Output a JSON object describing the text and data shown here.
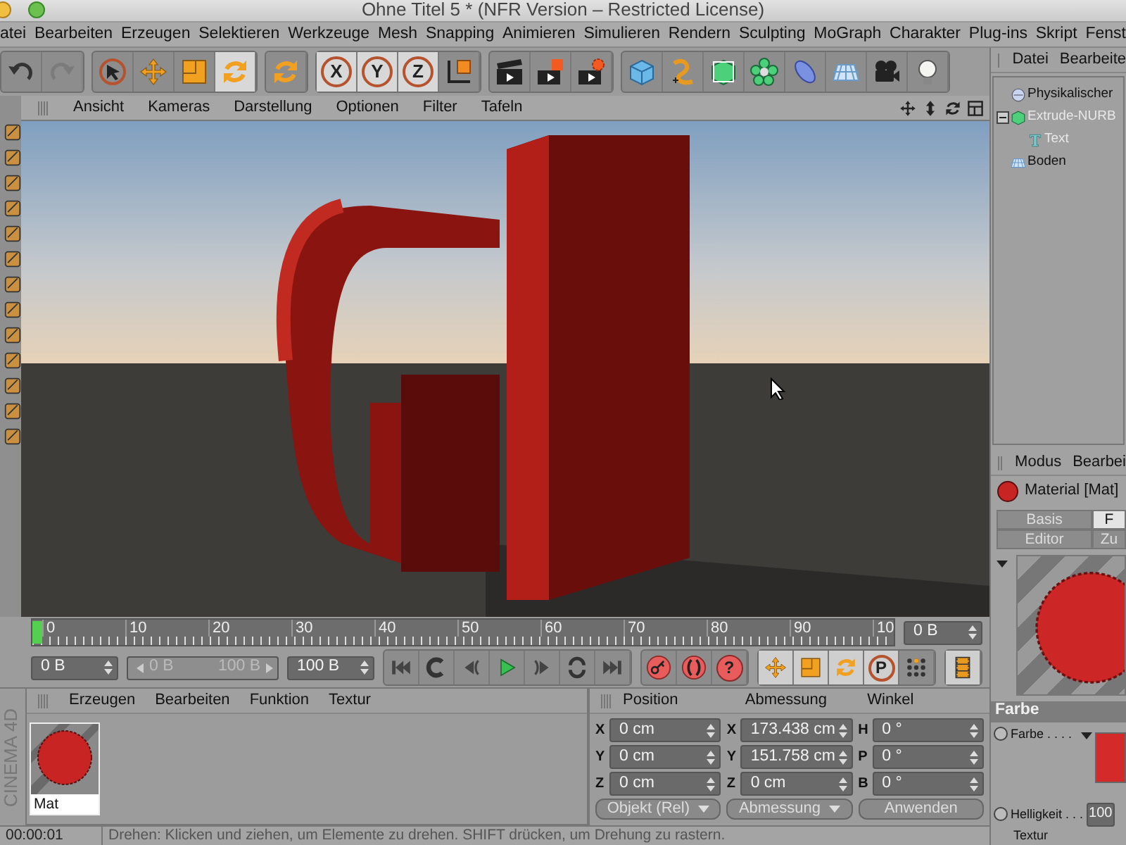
{
  "window": {
    "title": "Ohne Titel 5 * (NFR Version – Restricted License)"
  },
  "menu": [
    "atei",
    "Bearbeiten",
    "Erzeugen",
    "Selektieren",
    "Werkzeuge",
    "Mesh",
    "Snapping",
    "Animieren",
    "Simulieren",
    "Rendern",
    "Sculpting",
    "MoGraph",
    "Charakter",
    "Plug-ins",
    "Skript",
    "Fenst"
  ],
  "toolbar": {
    "groups": [
      [
        {
          "kind": "undo",
          "selected": false,
          "disabled": false
        },
        {
          "kind": "redo",
          "selected": false,
          "disabled": true
        }
      ],
      [
        {
          "kind": "select",
          "selected": false,
          "disabled": false
        },
        {
          "kind": "move",
          "selected": false,
          "disabled": false
        },
        {
          "kind": "scale",
          "selected": false,
          "disabled": false
        },
        {
          "kind": "rotate",
          "selected": true,
          "disabled": false
        }
      ],
      [
        {
          "kind": "rotate",
          "selected": false,
          "disabled": false
        }
      ],
      [
        {
          "kind": "axis",
          "label": "X",
          "selected": true,
          "disabled": false
        },
        {
          "kind": "axis",
          "label": "Y",
          "selected": true,
          "disabled": false
        },
        {
          "kind": "axis",
          "label": "Z",
          "selected": true,
          "disabled": false
        },
        {
          "kind": "coords",
          "selected": false,
          "disabled": false
        }
      ],
      [
        {
          "kind": "clapper",
          "selected": false,
          "disabled": false
        },
        {
          "kind": "clapper2",
          "selected": false,
          "disabled": false
        },
        {
          "kind": "clapper3",
          "selected": false,
          "disabled": false
        }
      ],
      [
        {
          "kind": "cube",
          "selected": false,
          "disabled": false
        },
        {
          "kind": "spline",
          "selected": false,
          "disabled": false
        },
        {
          "kind": "nurbs",
          "selected": false,
          "disabled": false
        },
        {
          "kind": "array",
          "selected": false,
          "disabled": false
        },
        {
          "kind": "deformer",
          "selected": false,
          "disabled": false
        },
        {
          "kind": "floor",
          "selected": false,
          "disabled": false
        },
        {
          "kind": "camera",
          "selected": false,
          "disabled": false
        },
        {
          "kind": "light",
          "selected": false,
          "disabled": false
        }
      ]
    ]
  },
  "viewport": {
    "menu": [
      "Ansicht",
      "Kameras",
      "Darstellung",
      "Optionen",
      "Filter",
      "Tafeln"
    ]
  },
  "timeline": {
    "labels": [
      "0",
      "10",
      "20",
      "30",
      "40",
      "50",
      "60",
      "70",
      "80",
      "90",
      "10"
    ],
    "playhead": {
      "level": 0
    },
    "frame_field": "0 B"
  },
  "controls": {
    "start": "0 B",
    "range": {
      "min": "0 B",
      "max": "100 B",
      "disabled": true
    },
    "end": "100 B",
    "transport": [
      {
        "kind": "tostart"
      },
      {
        "kind": "back"
      },
      {
        "kind": "stepback"
      },
      {
        "kind": "play"
      },
      {
        "kind": "stepfwd"
      },
      {
        "kind": "loop"
      },
      {
        "kind": "toend"
      }
    ],
    "record": [
      {
        "kind": "key"
      },
      {
        "kind": "autokey"
      },
      {
        "kind": "help",
        "label": "?"
      }
    ],
    "modes": [
      {
        "kind": "move"
      },
      {
        "kind": "scale"
      },
      {
        "kind": "rotate"
      },
      {
        "kind": "param",
        "label": "P"
      },
      {
        "kind": "dots"
      }
    ]
  },
  "materials": {
    "brand": "CINEMA 4D",
    "menu": [
      "Erzeugen",
      "Bearbeiten",
      "Funktion",
      "Textur"
    ],
    "items": [
      {
        "name": "Mat"
      }
    ]
  },
  "coordinates": {
    "headers": [
      "Position",
      "Abmessung",
      "Winkel"
    ],
    "rows": [
      [
        {
          "axis": "X",
          "value": "0 cm"
        },
        {
          "axis": "X",
          "value": "173.438 cm"
        },
        {
          "axis": "H",
          "value": "0 °"
        }
      ],
      [
        {
          "axis": "Y",
          "value": "0 cm"
        },
        {
          "axis": "Y",
          "value": "151.758 cm"
        },
        {
          "axis": "P",
          "value": "0 °"
        }
      ],
      [
        {
          "axis": "Z",
          "value": "0 cm"
        },
        {
          "axis": "Z",
          "value": "0 cm"
        },
        {
          "axis": "B",
          "value": "0 °"
        }
      ]
    ],
    "dropdowns": [
      "Objekt (Rel)",
      "Abmessung"
    ],
    "apply_button": "Anwenden"
  },
  "status_bar": {
    "time": "00:00:01",
    "message": "Drehen: Klicken und ziehen, um Elemente zu drehen. SHIFT drücken, um Drehung zu rastern."
  },
  "object_manager": {
    "menu": [
      "Datei",
      "Bearbeite"
    ],
    "objects": [
      {
        "kind": "sky",
        "name": "Physikalischer",
        "disabled": false
      },
      {
        "kind": "extrude",
        "name": "Extrude-NURB",
        "disabled": true,
        "expanded": true,
        "children": [
          {
            "kind": "text",
            "name": "Text",
            "disabled": true
          }
        ]
      },
      {
        "kind": "floor",
        "name": "Boden",
        "disabled": false
      }
    ]
  },
  "attribute_manager": {
    "menu": [
      "Modus",
      "Bearbei"
    ],
    "title": "Material [Mat]",
    "tabs": [
      {
        "label": "Basis",
        "selected": false
      },
      {
        "label": "F",
        "selected": true
      },
      {
        "label": "Editor",
        "selected": false
      },
      {
        "label": "Zu",
        "selected": false
      }
    ],
    "section": "Farbe",
    "params": [
      {
        "kind": "color",
        "label": "Farbe . . . .",
        "checked": false
      },
      {
        "kind": "number",
        "label": "Helligkeit . . .",
        "value": "100",
        "checked": false
      },
      {
        "kind": "texture",
        "label": "Textur"
      }
    ]
  }
}
